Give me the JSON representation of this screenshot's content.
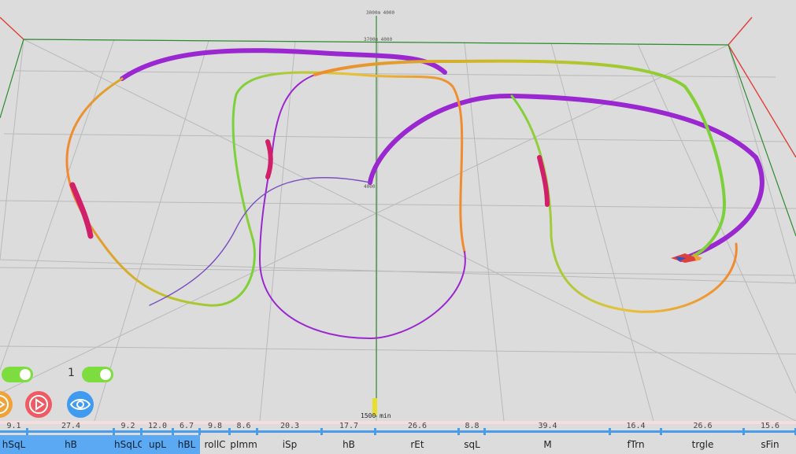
{
  "scene": {
    "label_top_a": "3000m 4000",
    "label_top_b": "3700m 4000",
    "label_center": "4000",
    "label_bottom": "1500 min"
  },
  "toggles": {
    "count": "1"
  },
  "buttons": {
    "orange": {
      "color": "#f0a238",
      "icon": "play-icon"
    },
    "play": {
      "color": "#ef5b63",
      "icon": "play-icon"
    },
    "view": {
      "color": "#3f9bf0",
      "icon": "eye-icon"
    }
  },
  "timeline": {
    "segments": [
      {
        "value": "9.1",
        "name": "hSqL",
        "selected": true
      },
      {
        "value": "27.4",
        "name": "hB",
        "selected": true
      },
      {
        "value": "9.2",
        "name": "hSqLC",
        "selected": true
      },
      {
        "value": "12.0",
        "name": "upL",
        "selected": true
      },
      {
        "value": "6.7",
        "name": "hBL",
        "selected": true
      },
      {
        "value": "9.8",
        "name": "rollC",
        "selected": false
      },
      {
        "value": "8.6",
        "name": "pImm",
        "selected": false
      },
      {
        "value": "20.3",
        "name": "iSp",
        "selected": false
      },
      {
        "value": "17.7",
        "name": "hB",
        "selected": false
      },
      {
        "value": "26.6",
        "name": "rEt",
        "selected": false
      },
      {
        "value": "8.8",
        "name": "sqL",
        "selected": false
      },
      {
        "value": "39.4",
        "name": "M",
        "selected": false
      },
      {
        "value": "16.4",
        "name": "fTrn",
        "selected": false
      },
      {
        "value": "26.6",
        "name": "trgle",
        "selected": false
      },
      {
        "value": "15.6",
        "name": "sFin",
        "selected": false
      }
    ]
  }
}
